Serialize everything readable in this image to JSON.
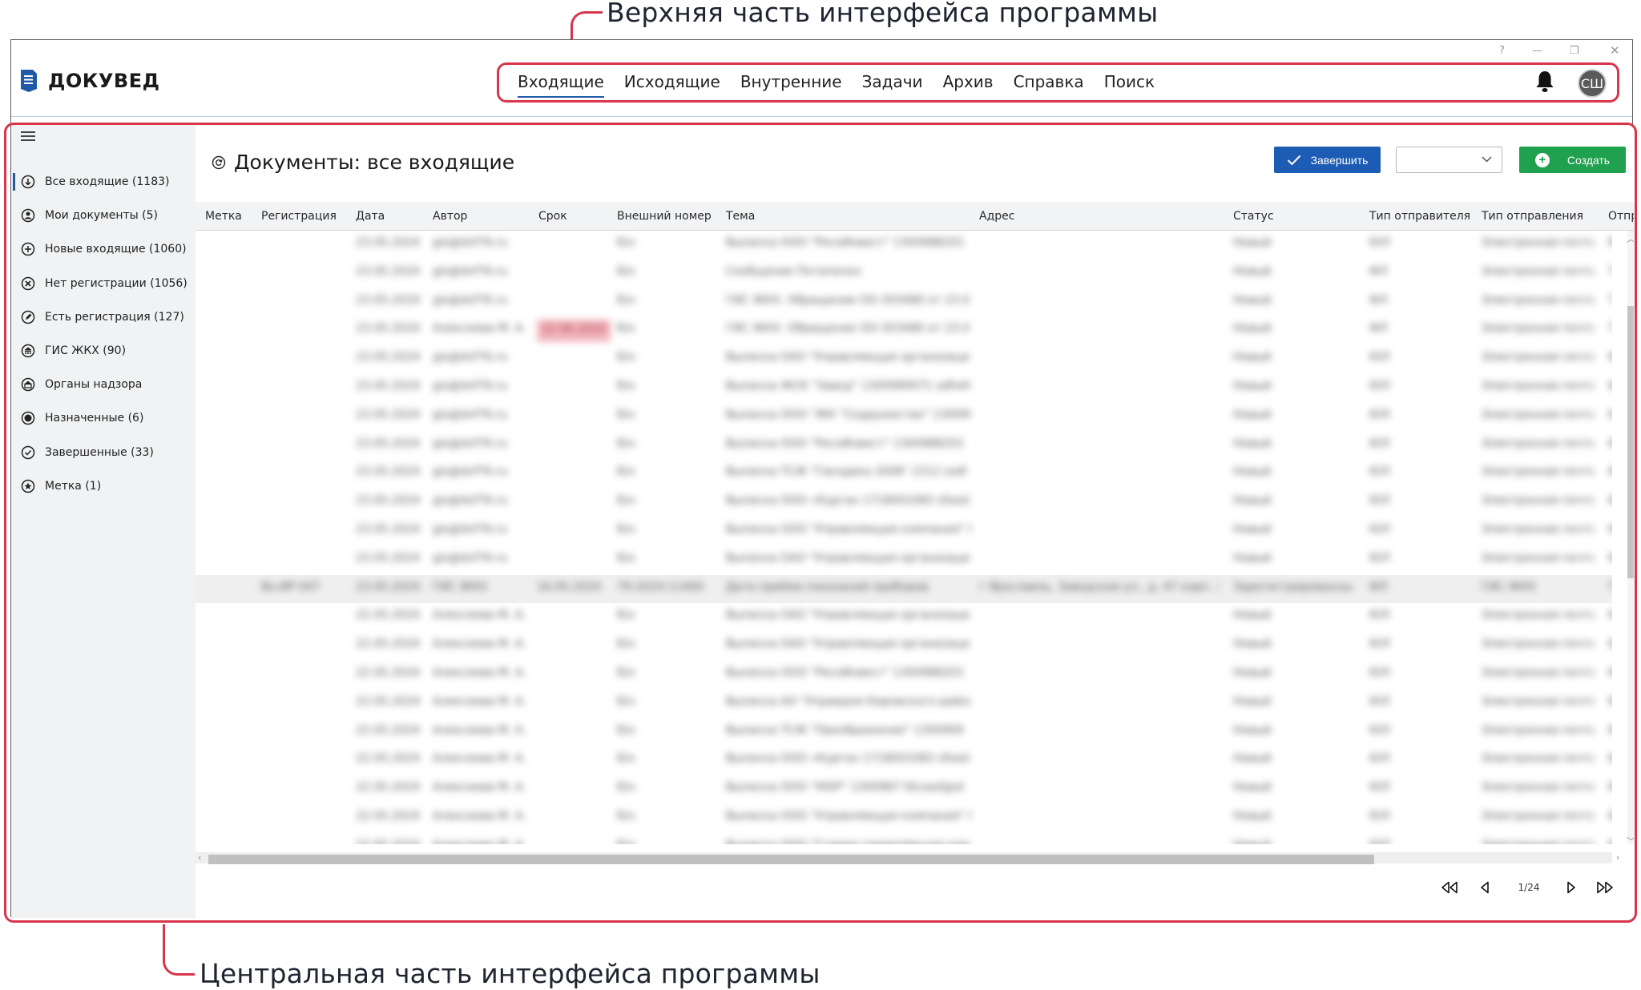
{
  "annotations": {
    "top": "Верхняя часть интерфейса программы",
    "bottom": "Центральная часть интерфейса программы"
  },
  "window": {
    "controls": {
      "help": "?",
      "minimize": "—",
      "maximize": "❐",
      "close": "✕"
    }
  },
  "app": {
    "title": "ДОКУВЕД",
    "accent": "#1f5aa8"
  },
  "nav": {
    "items": [
      {
        "label": "Входящие",
        "active": true
      },
      {
        "label": "Исходящие"
      },
      {
        "label": "Внутренние"
      },
      {
        "label": "Задачи"
      },
      {
        "label": "Архив"
      },
      {
        "label": "Справка"
      },
      {
        "label": "Поиск"
      }
    ]
  },
  "user": {
    "initials": "СШ"
  },
  "sidebar": {
    "items": [
      {
        "label": "Все входящие (1183)",
        "icon": "arrow-down-circle-icon",
        "active": true
      },
      {
        "label": "Мои документы (5)",
        "icon": "person-circle-icon"
      },
      {
        "label": "Новые входящие (1060)",
        "icon": "plus-circle-icon"
      },
      {
        "label": "Нет регистрации (1056)",
        "icon": "x-circle-icon"
      },
      {
        "label": "Есть регистрация (127)",
        "icon": "pen-circle-icon"
      },
      {
        "label": "ГИС ЖКХ (90)",
        "icon": "building-circle-icon"
      },
      {
        "label": "Органы надзора",
        "icon": "shield-circle-icon"
      },
      {
        "label": "Назначенные (6)",
        "icon": "dot-circle-icon"
      },
      {
        "label": "Завершенные (33)",
        "icon": "check-circle-icon"
      },
      {
        "label": "Метка (1)",
        "icon": "star-circle-icon"
      }
    ]
  },
  "page": {
    "title": "Документы: все входящие",
    "finish_label": "Завершить",
    "create_label": "Создать",
    "select_value": ""
  },
  "table": {
    "columns": [
      "Метка",
      "Регистрация",
      "Дата",
      "Автор",
      "Срок",
      "Внешний номер",
      "Тема",
      "Адрес",
      "Статус",
      "Тип отправителя",
      "Тип отправления",
      "Отпр"
    ],
    "rows": [
      {
        "date": "23.05.2024",
        "author": "gis@dvf76.ru",
        "ext": "б/н",
        "subject": "Выписка ООО \"РесоИнвест\" 1300988201",
        "status": "Новый",
        "stype": "ЮЛ",
        "sendtype": "Электронная почта",
        "extra": "Ю"
      },
      {
        "date": "23.05.2024",
        "author": "gis@dvf76.ru",
        "ext": "б/н",
        "subject": "Сообщение Потапенко",
        "status": "Новый",
        "stype": "ФЛ",
        "sendtype": "Электронная почта",
        "extra": "Т"
      },
      {
        "date": "23.05.2024",
        "author": "gis@dvf76.ru",
        "ext": "б/н",
        "subject": "ГИС ЖКХ. Обращение ОО-303480 от 23.05.24",
        "status": "Новый",
        "stype": "ФЛ",
        "sendtype": "Электронная почта",
        "extra": "Т"
      },
      {
        "date": "23.05.2024",
        "author": "Алексеева М. А.",
        "deadline": "22.06.2024",
        "ext": "б/н",
        "subject": "ГИС ЖКХ. Обращение ОО-303480 от 23.05.24",
        "status": "Новый",
        "stype": "ФЛ",
        "sendtype": "Электронная почта",
        "extra": "Т"
      },
      {
        "date": "23.05.2024",
        "author": "gis@dvf76.ru",
        "ext": "б/н",
        "subject": "Выписка ОАО \"Управляющая организация\"",
        "status": "Новый",
        "stype": "ЮЛ",
        "sendtype": "Электронная почта",
        "extra": "Ю"
      },
      {
        "date": "23.05.2024",
        "author": "gis@dvf76.ru",
        "ext": "б/н",
        "subject": "Выписка ЖСК \"Завод\" 1300999071 sdfrefd",
        "status": "Новый",
        "stype": "ЮЛ",
        "sendtype": "Электронная почта",
        "extra": "Ю"
      },
      {
        "date": "23.05.2024",
        "author": "gis@dvf76.ru",
        "ext": "б/н",
        "subject": "Выписка ООО \"ЖК \"Содружество\" 1300906",
        "status": "Новый",
        "stype": "ЮЛ",
        "sendtype": "Электронная почта",
        "extra": "Ю"
      },
      {
        "date": "23.05.2024",
        "author": "gis@dvf76.ru",
        "ext": "б/н",
        "subject": "Выписка ООО \"РесоИнвест\" 1300988201",
        "status": "Новый",
        "stype": "ЮЛ",
        "sendtype": "Электронная почта",
        "extra": "Ю"
      },
      {
        "date": "23.05.2024",
        "author": "gis@dvf76.ru",
        "ext": "б/н",
        "subject": "Выписка ТСЖ \"Гвоздика 2008\" 2312 ssdf",
        "status": "Новый",
        "stype": "ЮЛ",
        "sendtype": "Электронная почта",
        "extra": "Ю"
      },
      {
        "date": "23.05.2024",
        "author": "gis@dvf76.ru",
        "ext": "б/н",
        "subject": "Выписка ООО «Курган 1718001083 sfsed»",
        "status": "Новый",
        "stype": "ЮЛ",
        "sendtype": "Электронная почта",
        "extra": "Ю"
      },
      {
        "date": "23.05.2024",
        "author": "gis@dvf76.ru",
        "ext": "б/н",
        "subject": "Выписка ООО \"Управляющая компания\" Н",
        "status": "Новый",
        "stype": "ЮЛ",
        "sendtype": "Электронная почта",
        "extra": "Ю"
      },
      {
        "date": "23.05.2024",
        "author": "gis@dvf76.ru",
        "ext": "б/н",
        "subject": "Выписка ОАО \"Управляющая организация\"",
        "status": "Новый",
        "stype": "ЮЛ",
        "sendtype": "Электронная почта",
        "extra": "Ю"
      },
      {
        "highlight": true,
        "reg": "Вх-ИР 047",
        "date": "23.05.2024",
        "author": "ГИС ЖКХ",
        "deadline": "16.05.2024",
        "ext": "79-2024-11400",
        "subject": "Дата приёма показаний приборов",
        "address": "г Ярославль, Заводская ул., д. 47 корп. 3",
        "status": "Зарегистрированный",
        "stype": "ФЛ",
        "sendtype": "ГИС ЖКХ",
        "extra": "Т"
      },
      {
        "date": "22.05.2024",
        "author": "Алексеева М. А.",
        "ext": "б/н",
        "subject": "Выписка ОАО \"Управляющая организация\"",
        "status": "Новый",
        "stype": "ЮЛ",
        "sendtype": "Электронная почта",
        "extra": "Ю"
      },
      {
        "date": "22.05.2024",
        "author": "Алексеева М. А.",
        "ext": "б/н",
        "subject": "Выписка ОАО \"Управляющая организация\"",
        "status": "Новый",
        "stype": "ЮЛ",
        "sendtype": "Электронная почта",
        "extra": "Ю"
      },
      {
        "date": "22.05.2024",
        "author": "Алексеева М. А.",
        "ext": "б/н",
        "subject": "Выписка ООО \"РесоИнвест\" 1300988201",
        "status": "Новый",
        "stype": "ЮЛ",
        "sendtype": "Электронная почта",
        "extra": "Ю"
      },
      {
        "date": "22.05.2024",
        "author": "Алексеева М. А.",
        "ext": "б/н",
        "subject": "Выписка АО \"Управдом Кировского района\"",
        "status": "Новый",
        "stype": "ЮЛ",
        "sendtype": "Электронная почта",
        "extra": "Ю"
      },
      {
        "date": "22.05.2024",
        "author": "Алексеева М. А.",
        "ext": "б/н",
        "subject": "Выписка ТСЖ \"Преображение\" 1300909",
        "status": "Новый",
        "stype": "ЮЛ",
        "sendtype": "Электронная почта",
        "extra": "Ю"
      },
      {
        "date": "22.05.2024",
        "author": "Алексеева М. А.",
        "ext": "б/н",
        "subject": "Выписка ООО «Курган 1718001083 sfsed»",
        "status": "Новый",
        "stype": "ЮЛ",
        "sendtype": "Электронная почта",
        "extra": "Ю"
      },
      {
        "date": "22.05.2024",
        "author": "Алексеева М. А.",
        "ext": "б/н",
        "subject": "Выписка ООО \"УЮР\" 1300987 fdcsasfgsd",
        "status": "Новый",
        "stype": "ЮЛ",
        "sendtype": "Электронная почта",
        "extra": "Ю"
      },
      {
        "date": "22.05.2024",
        "author": "Алексеева М. А.",
        "ext": "б/н",
        "subject": "Выписка ООО \"Управляющая компания\" Н",
        "status": "Новый",
        "stype": "ЮЛ",
        "sendtype": "Электронная почта",
        "extra": "Ю"
      },
      {
        "date": "22.05.2024",
        "author": "Алексеева М. А.",
        "ext": "б/н",
        "subject": "Выписка ООО \"Старая управляющая ком",
        "status": "Новый",
        "stype": "ЮЛ",
        "sendtype": "Электронная почта",
        "extra": "Ю"
      }
    ]
  },
  "pager": {
    "label": "1/24"
  }
}
